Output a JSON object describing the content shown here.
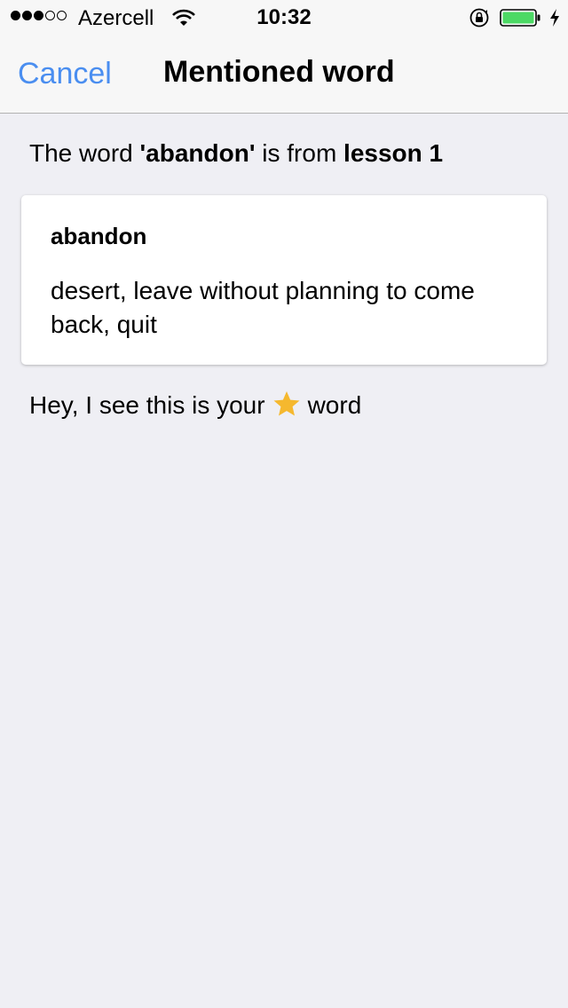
{
  "status_bar": {
    "signal_filled": 3,
    "signal_total": 5,
    "carrier": "Azercell",
    "time": "10:32",
    "battery_color": "#4cd964"
  },
  "nav": {
    "cancel_label": "Cancel",
    "title": "Mentioned word"
  },
  "info": {
    "prefix": "The word ",
    "word_quoted": "'abandon'",
    "middle": " is from ",
    "lesson": "lesson 1"
  },
  "card": {
    "word": "abandon",
    "definition": "desert, leave without planning to come back, quit"
  },
  "favorite": {
    "prefix": "Hey, I see this is your",
    "icon": "star-icon",
    "star_color": "#f5b82e",
    "suffix": "word"
  },
  "colors": {
    "accent": "#4a8ef0",
    "background": "#efeff4"
  }
}
